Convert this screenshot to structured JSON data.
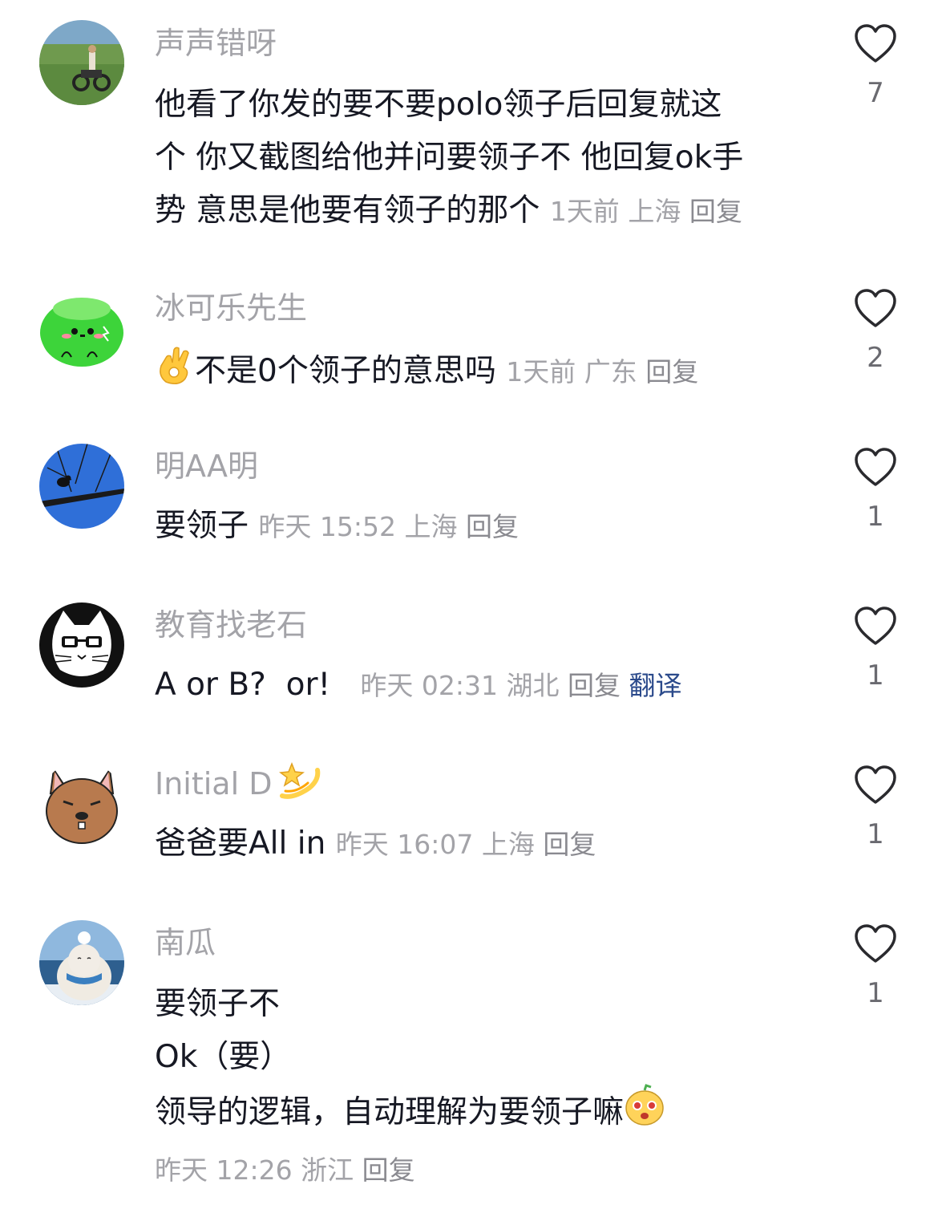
{
  "comments": [
    {
      "username": "声声错呀",
      "lines": [
        "他看了你发的要不要polo领子后回复就这",
        "个 你又截图给他并问要领子不 他回复ok手",
        "势 意思是他要有领子的那个"
      ],
      "time": "1天前",
      "location": "上海",
      "reply": "回复",
      "likes": "7"
    },
    {
      "username": "冰可乐先生",
      "lines": [
        "不是0个领子的意思吗"
      ],
      "time": "1天前",
      "location": "广东",
      "reply": "回复",
      "likes": "2"
    },
    {
      "username": "明AA明",
      "lines": [
        "要领子"
      ],
      "time": "昨天 15:52",
      "location": "上海",
      "reply": "回复",
      "likes": "1"
    },
    {
      "username": "教育找老石",
      "lines": [
        "A or B?  or!"
      ],
      "time": "昨天 02:31",
      "location": "湖北",
      "reply": "回复",
      "translate": "翻译",
      "likes": "1"
    },
    {
      "username": "Initial D",
      "lines": [
        "爸爸要All in"
      ],
      "time": "昨天 16:07",
      "location": "上海",
      "reply": "回复",
      "likes": "1"
    },
    {
      "username": "南瓜",
      "lines": [
        "要领子不",
        "Ok（要）",
        "领导的逻辑，自动理解为要领子嘛"
      ],
      "time": "昨天 12:26",
      "location": "浙江",
      "reply": "回复",
      "likes": "1"
    }
  ],
  "icons": {
    "like": "heart-outline-icon",
    "ok_hand": "ok-hand-emoji",
    "dizzy": "dizzy-star-emoji",
    "sticker": "cute-face-sticker"
  },
  "colors": {
    "username": "#a3a3a8",
    "text": "#161823",
    "translate": "#2b4a8b"
  }
}
